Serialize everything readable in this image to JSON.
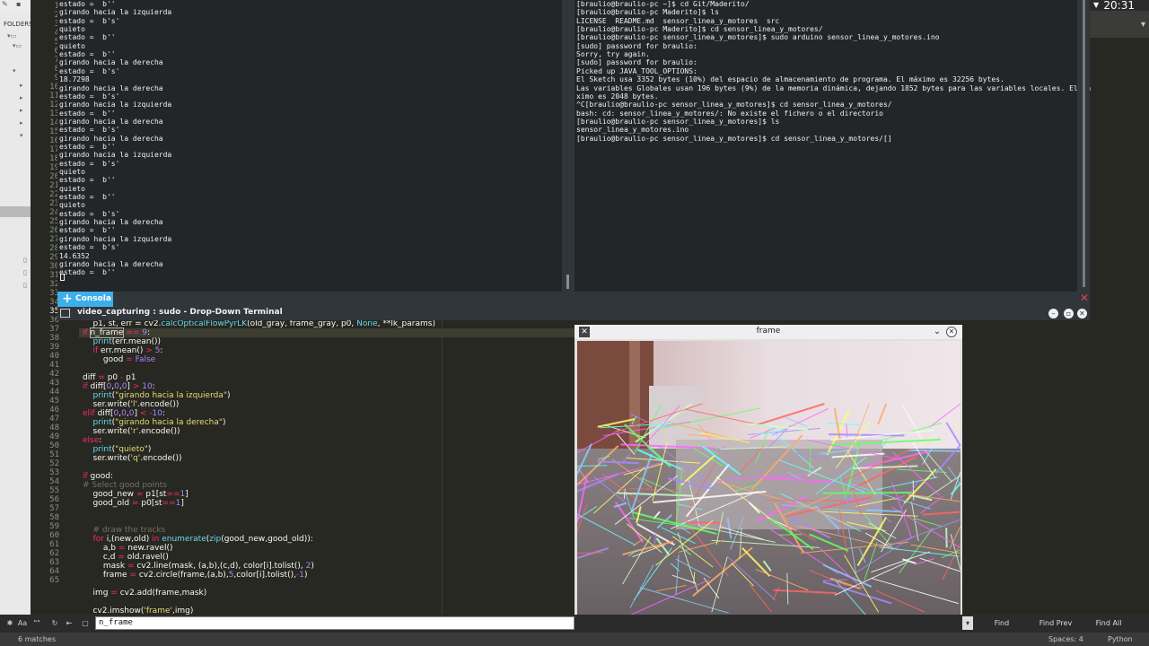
{
  "clock": "20:31",
  "sidebar": {
    "folders_label": "FOLDERS"
  },
  "editor": {
    "line_numbers": [
      "1",
      "2",
      "3",
      "4",
      "5",
      "6",
      "7",
      "8",
      "9",
      "10",
      "11",
      "12",
      "13",
      "14",
      "15",
      "16",
      "17",
      "18",
      "19",
      "20",
      "21",
      "22",
      "23",
      "24",
      "25",
      "26",
      "27",
      "28",
      "29",
      "30",
      "31",
      "32",
      "33",
      "34",
      "35",
      "36",
      "37",
      "38",
      "39",
      "40",
      "41",
      "42",
      "43",
      "44",
      "45",
      "46",
      "47",
      "48",
      "49",
      "50",
      "51",
      "52",
      "53",
      "54",
      "55",
      "56",
      "57",
      "58",
      "59",
      "60",
      "61",
      "62",
      "63",
      "64",
      "65"
    ],
    "current_line": "35"
  },
  "terminal_left": {
    "lines": [
      "estado =  b''",
      "girando hacia la izquierda",
      "estado =  b's'",
      "quieto",
      "estado =  b''",
      "quieto",
      "estado =  b''",
      "girando hacia la derecha",
      "estado =  b's'",
      "18.7298",
      "girando hacia la derecha",
      "estado =  b's'",
      "girando hacia la izquierda",
      "estado =  b''",
      "girando hacia la derecha",
      "estado =  b's'",
      "girando hacia la derecha",
      "estado =  b''",
      "girando hacia la izquierda",
      "estado =  b's'",
      "quieto",
      "estado =  b''",
      "quieto",
      "estado =  b''",
      "quieto",
      "estado =  b's'",
      "girando hacia la derecha",
      "estado =  b''",
      "girando hacia la izquierda",
      "estado =  b's'",
      "14.6352",
      "girando hacia la derecha",
      "estado =  b''",
      ""
    ]
  },
  "terminal_right": {
    "lines": [
      "[braulio@braulio-pc ~]$ cd Git/Maderito/",
      "[braulio@braulio-pc Maderito]$ ls",
      "LICENSE  README.md  sensor_linea_y_motores  src",
      "[braulio@braulio-pc Maderito]$ cd sensor_linea_y_motores/",
      "[braulio@braulio-pc sensor_linea_y_motores]$ sudo arduino sensor_linea_y_motores.ino",
      "[sudo] password for braulio:",
      "Sorry, try again.",
      "[sudo] password for braulio:",
      "Picked up JAVA_TOOL_OPTIONS:",
      "El Sketch usa 3352 bytes (10%) del espacio de almacenamiento de programa. El máximo es 32256 bytes.",
      "Las variables Globales usan 196 bytes (9%) de la memoria dinámica, dejando 1852 bytes para las variables locales. El má",
      "ximo es 2048 bytes.",
      "^C[braulio@braulio-pc sensor_linea_y_motores]$ cd sensor_linea_y_motores/",
      "bash: cd: sensor_linea_y_motores/: No existe el fichero o el directorio",
      "[braulio@braulio-pc sensor_linea_y_motores]$ ls",
      "sensor_linea_y_motores.ino",
      "[braulio@braulio-pc sensor_linea_y_motores]$ cd sensor_linea_y_motores/[]"
    ]
  },
  "terminal_tab": {
    "label": "Consola"
  },
  "terminal_window": {
    "title": "video_capturing : sudo - Drop-Down Terminal"
  },
  "frame_window": {
    "title": "frame"
  },
  "find_bar": {
    "query": "n_frame",
    "case_label": "Aa",
    "word_label": "\"\"",
    "find_label": "Find",
    "find_prev_label": "Find Prev",
    "find_all_label": "Find All"
  },
  "status_bar": {
    "matches": "6 matches",
    "indent": "Spaces: 4",
    "syntax": "Python"
  },
  "colors": {
    "terminal_bg": "#232629",
    "tab_active": "#3daee9",
    "editor_bg": "#272822"
  }
}
